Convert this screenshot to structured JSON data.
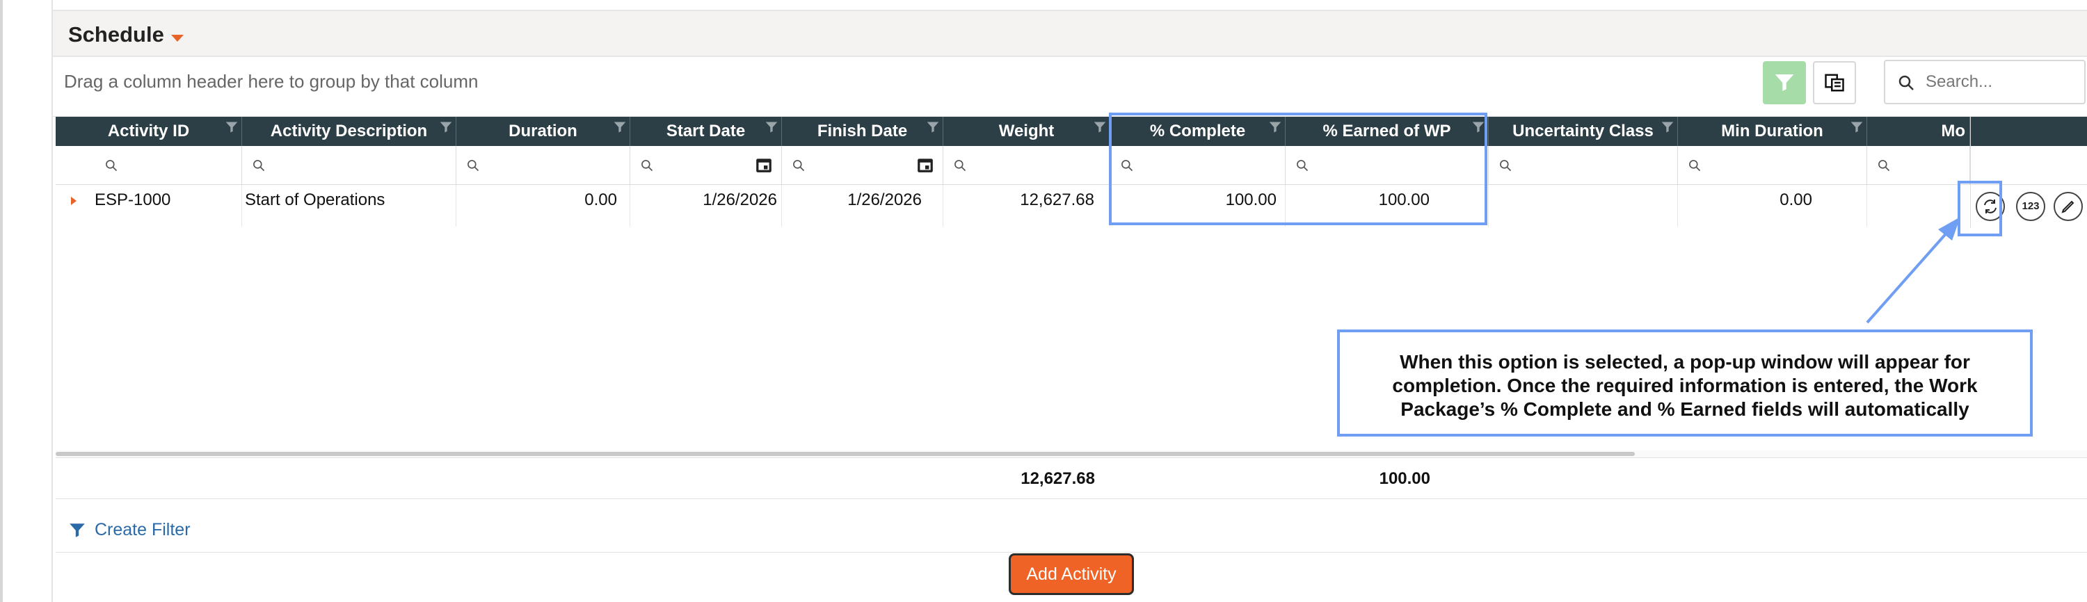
{
  "panel": {
    "title": "Schedule",
    "group_hint": "Drag a column header here to group by that column",
    "search_placeholder": "Search..."
  },
  "columns": [
    {
      "label": "Activity ID"
    },
    {
      "label": "Activity Description"
    },
    {
      "label": "Duration"
    },
    {
      "label": "Start Date"
    },
    {
      "label": "Finish Date"
    },
    {
      "label": "Weight"
    },
    {
      "label": "% Complete"
    },
    {
      "label": "% Earned of WP"
    },
    {
      "label": "Uncertainty Class"
    },
    {
      "label": "Min Duration"
    },
    {
      "label": "Mo"
    }
  ],
  "rows": [
    {
      "activity_id": "ESP-1000",
      "description": "Start of Operations",
      "duration": "0.00",
      "start_date": "1/26/2026",
      "finish_date": "1/26/2026",
      "weight": "12,627.68",
      "pct_complete": "100.00",
      "pct_earned": "100.00",
      "uncertainty_class": "",
      "min_duration": "0.00"
    }
  ],
  "row_actions": {
    "progress_label": "123"
  },
  "totals": {
    "weight": "12,627.68",
    "pct_earned": "100.00"
  },
  "create_filter_label": "Create Filter",
  "add_activity_label": "Add Activity",
  "annotation": {
    "text": "When this option is selected, a pop-up window will appear for completion. Once the required information is entered, the Work Package’s % Complete and % Earned fields will automatically"
  },
  "colors": {
    "accent": "#ef6327",
    "header_bg": "#2c3e46",
    "annotation": "#6f9ef2",
    "link": "#2a6aa8"
  }
}
